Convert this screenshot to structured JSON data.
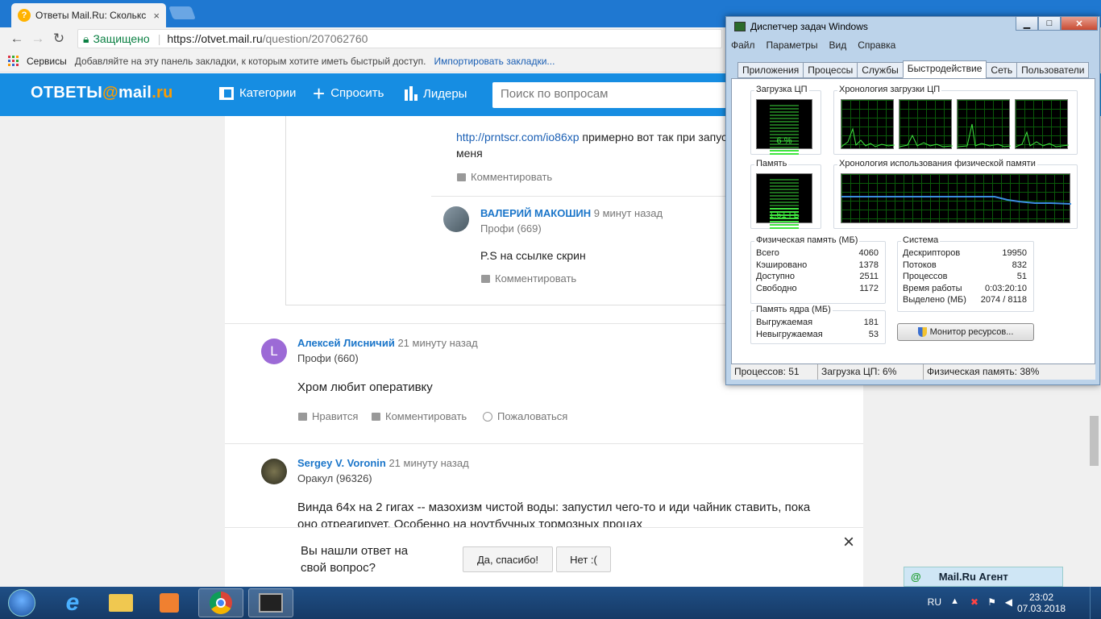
{
  "browser": {
    "tab_title": "Ответы Mail.Ru: Сколькс",
    "tab_close": "×",
    "secure_label": "Защищено",
    "url_host": "https://otvet.mail.ru",
    "url_path": "/question/207062760",
    "bookmarks": {
      "services": "Сервисы",
      "hint": "Добавляйте на эту панель закладки, к которым хотите иметь быстрый доступ.",
      "import": "Импортировать закладки..."
    }
  },
  "site": {
    "logo_left": "ОТВЕТЫ",
    "logo_at": "@",
    "logo_mail": "mail",
    "logo_ru": ".ru",
    "nav": {
      "categories": "Категории",
      "ask": "Спросить",
      "leaders": "Лидеры"
    },
    "search_placeholder": "Поиск по вопросам"
  },
  "thread": {
    "top_comment": {
      "link": "http://prntscr.com/io86xp",
      "text": "примерно вот так при запус",
      "text2": "меня",
      "comment_action": "Комментировать"
    },
    "reply": {
      "author": "ВАЛЕРИЙ МАКОШИН",
      "time": "9 минут назад",
      "rank": "Профи (669)",
      "text": "P.S на ссылке скрин",
      "comment_action": "Комментировать"
    }
  },
  "answers": [
    {
      "author": "Алексей Лисничий",
      "avatar_letter": "L",
      "time": "21 минуту назад",
      "rank": "Профи (660)",
      "text": "Хром любит оперативку",
      "like": "Нравится",
      "comment": "Комментировать",
      "report": "Пожаловаться"
    },
    {
      "author": "Sergey V. Voronin",
      "time": "21 минуту назад",
      "rank": "Оракул (96326)",
      "text": "Винда 64х на 2 гигах -- мазохизм чистой воды: запустил чего-то и иди чайник ставить, пока",
      "text2": "оно отреагирует. Особенно на ноутбучных тормозных процах"
    }
  ],
  "feedback": {
    "question": "Вы нашли ответ на",
    "question2": "свой вопрос?",
    "yes": "Да, спасибо!",
    "no": "Нет :(",
    "close": "×"
  },
  "agent": {
    "label": "Mail.Ru Агент",
    "icon": "@"
  },
  "taskmgr": {
    "title": "Диспетчер задач Windows",
    "menu": [
      "Файл",
      "Параметры",
      "Вид",
      "Справка"
    ],
    "tabs": [
      "Приложения",
      "Процессы",
      "Службы",
      "Быстродействие",
      "Сеть",
      "Пользователи"
    ],
    "cpu_label": "Загрузка ЦП",
    "cpu_value": "6 %",
    "cpu_hist_label": "Хронология загрузки ЦП",
    "mem_label": "Память",
    "mem_value": "1,51 ГБ",
    "mem_hist_label": "Хронология использования физической памяти",
    "phys": {
      "label": "Физическая память (МБ)",
      "rows": [
        [
          "Всего",
          "4060"
        ],
        [
          "Кэшировано",
          "1378"
        ],
        [
          "Доступно",
          "2511"
        ],
        [
          "Свободно",
          "1172"
        ]
      ]
    },
    "kernel": {
      "label": "Память ядра (МБ)",
      "rows": [
        [
          "Выгружаемая",
          "181"
        ],
        [
          "Невыгружаемая",
          "53"
        ]
      ]
    },
    "system": {
      "label": "Система",
      "rows": [
        [
          "Дескрипторов",
          "19950"
        ],
        [
          "Потоков",
          "832"
        ],
        [
          "Процессов",
          "51"
        ],
        [
          "Время работы",
          "0:03:20:10"
        ],
        [
          "Выделено (МБ)",
          "2074 / 8118"
        ]
      ]
    },
    "resource_button": "Монитор ресурсов...",
    "status": {
      "processes": "Процессов: 51",
      "cpu": "Загрузка ЦП: 6%",
      "mem": "Физическая память: 38%"
    }
  },
  "tray": {
    "lang": "RU",
    "time": "23:02",
    "date": "07.03.2018"
  },
  "colors": {
    "accent": "#168de2",
    "logo_at": "#fc9c00",
    "link": "#1a5fb4",
    "gauge_green": "#3fe63f"
  }
}
